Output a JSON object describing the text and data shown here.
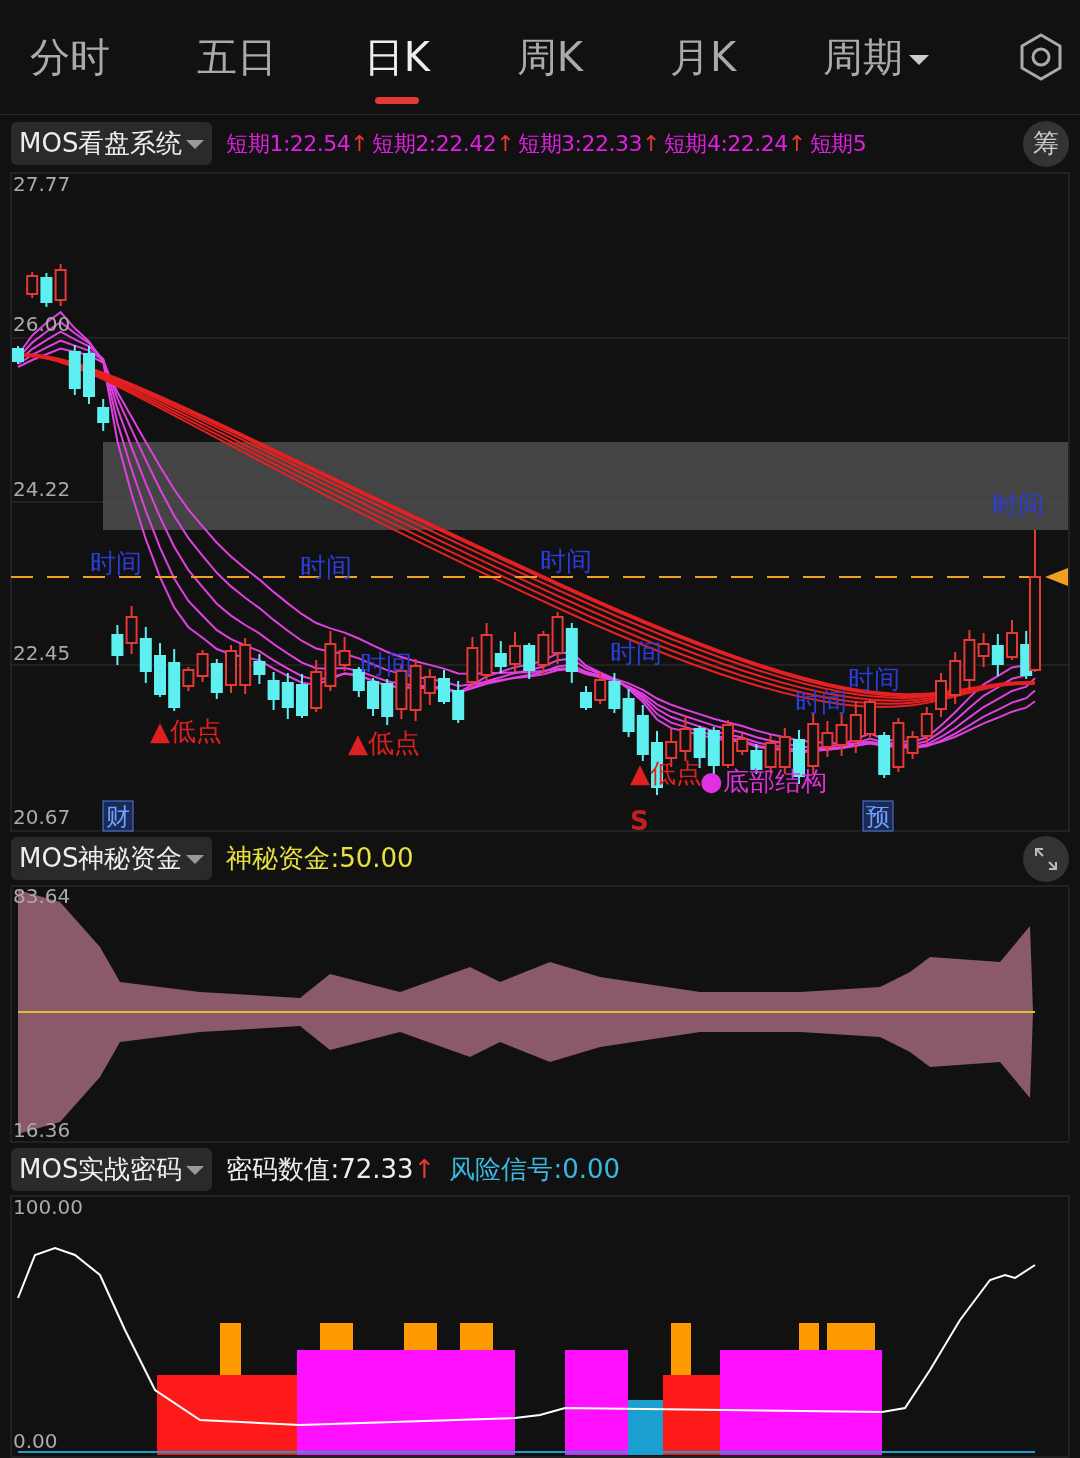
{
  "tabs": [
    {
      "label": "分时",
      "kind": "tab",
      "selected": false
    },
    {
      "label": "五日",
      "kind": "tab",
      "selected": false
    },
    {
      "label": "日K",
      "kind": "tab",
      "selected": true
    },
    {
      "label": "周K",
      "kind": "tab",
      "selected": false
    },
    {
      "label": "月K",
      "kind": "tab",
      "selected": false
    },
    {
      "label": "周期",
      "kind": "dropdown",
      "selected": false
    }
  ],
  "main_panel": {
    "indicator": "MOS看盘系统",
    "legend": [
      {
        "text": "短期1:22.54",
        "arrow": "↑"
      },
      {
        "text": "短期2:22.42",
        "arrow": "↑"
      },
      {
        "text": "短期3:22.33",
        "arrow": "↑"
      },
      {
        "text": "短期4:22.24",
        "arrow": "↑"
      },
      {
        "text": "短期5"
      }
    ],
    "side_button": "筹",
    "y_labels": [
      "27.77",
      "26.00",
      "24.22",
      "22.45",
      "20.67"
    ],
    "markers": [
      {
        "kind": "time",
        "text": "时间"
      },
      {
        "kind": "time",
        "text": "时间"
      },
      {
        "kind": "time",
        "text": "时间"
      },
      {
        "kind": "time",
        "text": "时间"
      },
      {
        "kind": "time",
        "text": "时间"
      },
      {
        "kind": "time",
        "text": "时间"
      },
      {
        "kind": "time",
        "text": "时间"
      },
      {
        "kind": "time",
        "text": "时间"
      },
      {
        "kind": "low",
        "text": "▲低点"
      },
      {
        "kind": "low",
        "text": "▲低点"
      },
      {
        "kind": "low",
        "text": "▲低点"
      },
      {
        "kind": "bottom",
        "text": "●底部结构"
      },
      {
        "kind": "boxed",
        "text": "财"
      },
      {
        "kind": "signal",
        "text": "S"
      },
      {
        "kind": "boxed",
        "text": "预"
      }
    ]
  },
  "fund_panel": {
    "indicator": "MOS神秘资金",
    "readouts": [
      {
        "kind": "fund",
        "text": "神秘资金:50.00"
      }
    ],
    "y_labels": [
      "83.64",
      "16.36"
    ]
  },
  "code_panel": {
    "indicator": "MOS实战密码",
    "readouts": [
      {
        "kind": "value",
        "text": "密码数值:72.33",
        "arrow": "↑"
      },
      {
        "kind": "risk",
        "text": "风险信号:0.00"
      }
    ],
    "y_labels": [
      "100.00",
      "0.00"
    ]
  }
}
